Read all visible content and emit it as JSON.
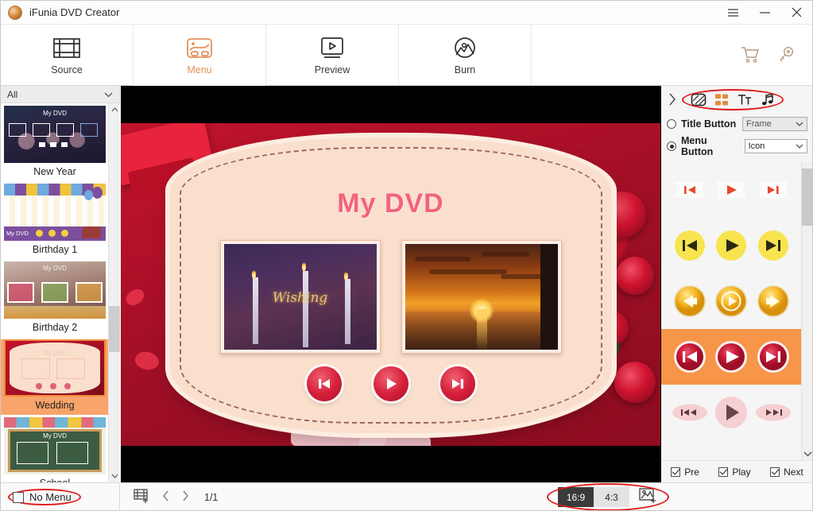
{
  "window": {
    "title": "iFunia DVD Creator",
    "logo_icon": "app-logo-icon",
    "menu_icon": "hamburger-menu-icon",
    "minimize_icon": "minimize-icon",
    "close_icon": "close-icon"
  },
  "topnav": {
    "tabs": [
      {
        "label": "Source",
        "icon": "film-strip-icon",
        "active": false
      },
      {
        "label": "Menu",
        "icon": "menu-layout-icon",
        "active": true
      },
      {
        "label": "Preview",
        "icon": "monitor-play-icon",
        "active": false
      },
      {
        "label": "Burn",
        "icon": "disc-burn-icon",
        "active": false
      }
    ],
    "cart_icon": "shopping-cart-icon",
    "key_icon": "key-icon",
    "active_color": "#e2915c"
  },
  "sidebar": {
    "category": "All",
    "category_chevron_icon": "chevron-down-icon",
    "scroll_up_icon": "chevron-up-icon",
    "scroll_down_icon": "chevron-down-icon",
    "templates": [
      {
        "name": "New Year",
        "selected": false
      },
      {
        "name": "Birthday 1",
        "selected": false
      },
      {
        "name": "Birthday 2",
        "selected": false
      },
      {
        "name": "Wedding",
        "selected": true
      },
      {
        "name": "School",
        "selected": false
      }
    ],
    "no_menu_label": "No Menu",
    "no_menu_checked": false,
    "highlight_color": "#e01b1b",
    "selected_color": "#f8a46b"
  },
  "preview": {
    "dvd_title": "My DVD",
    "dvd_title_color": "#f2637d",
    "thumbnails": [
      {
        "name": "candles-wishing-thumbnail",
        "caption": "Wishing"
      },
      {
        "name": "sunset-ocean-thumbnail",
        "caption": ""
      }
    ],
    "buttons": [
      {
        "name": "previous-button",
        "icon": "skip-previous-icon"
      },
      {
        "name": "play-button",
        "icon": "play-icon"
      },
      {
        "name": "next-button",
        "icon": "skip-next-icon"
      }
    ],
    "button_color": "#d6203c"
  },
  "rightpanel": {
    "collapse_icon": "chevron-right-icon",
    "tabs": [
      {
        "name": "background-tab",
        "icon": "background-image-icon"
      },
      {
        "name": "layout-tab",
        "icon": "layout-grid-icon"
      },
      {
        "name": "text-tab",
        "icon": "text-format-icon"
      },
      {
        "name": "music-tab",
        "icon": "music-note-icon"
      }
    ],
    "tabs_highlight_color": "#e01b1b",
    "title_button": {
      "label": "Title Button",
      "selected": false,
      "value": "Frame",
      "enabled": false,
      "chevron_icon": "chevron-down-icon"
    },
    "menu_button": {
      "label": "Menu Button",
      "selected": true,
      "value": "Icon",
      "enabled": true,
      "chevron_icon": "chevron-down-icon"
    },
    "style_rows": [
      {
        "name": "style-row-ribbon-red",
        "selected": false,
        "style": "ribbon"
      },
      {
        "name": "style-row-yellow-flat",
        "selected": false,
        "style": "yellow"
      },
      {
        "name": "style-row-gold-gloss",
        "selected": false,
        "style": "gold"
      },
      {
        "name": "style-row-crimson-ring",
        "selected": true,
        "style": "crimson"
      },
      {
        "name": "style-row-pink-pill",
        "selected": false,
        "style": "pink"
      },
      {
        "name": "style-row-faint-gray",
        "selected": false,
        "style": "faint"
      }
    ],
    "selected_row_color": "#f79548",
    "checkboxes": [
      {
        "label": "Pre",
        "checked": true
      },
      {
        "label": "Play",
        "checked": true
      },
      {
        "label": "Next",
        "checked": true
      }
    ],
    "scroll_down_icon": "chevron-down-icon"
  },
  "bottombar": {
    "add_menu_icon": "add-film-icon",
    "prev_page_icon": "chevron-left-icon",
    "next_page_icon": "chevron-right-icon",
    "page_indicator": "1/1",
    "ratios": [
      {
        "label": "16:9",
        "selected": true
      },
      {
        "label": "4:3",
        "selected": false
      }
    ],
    "add_image_icon": "add-image-icon",
    "highlight_color": "#e01b1b"
  }
}
